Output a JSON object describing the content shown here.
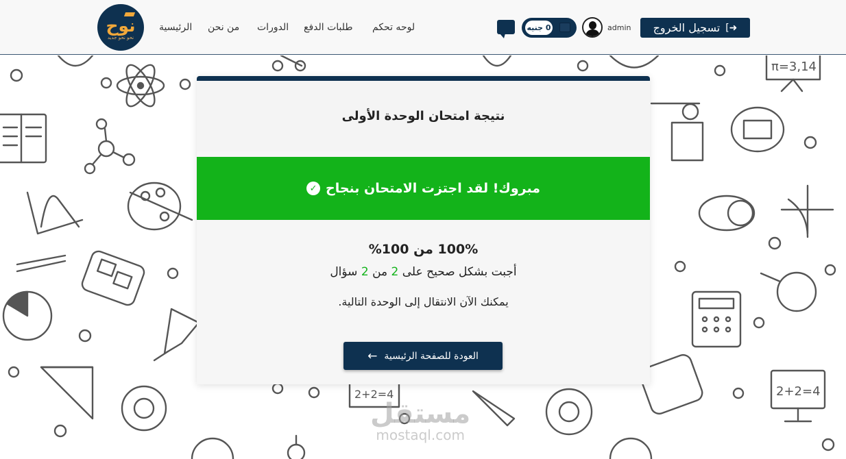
{
  "header": {
    "logo": {
      "word": "نوح",
      "tagline": "نحو نحو جديد"
    },
    "nav": [
      {
        "label": "الرئيسية"
      },
      {
        "label": "من نحن"
      },
      {
        "label": "الدورات"
      },
      {
        "label": "طلبات الدفع"
      },
      {
        "label": "لوحه تحكم"
      }
    ],
    "wallet": {
      "balance": "0 جنيه"
    },
    "username": "admin",
    "logout_label": "تسجيل الخروج"
  },
  "card": {
    "title": "نتيجة امتحان الوحدة الأولى",
    "success_message": "مبروك! لقد اجتزت الامتحان بنجاح",
    "score": "100% من 100%",
    "answered_prefix": "أجبت بشكل صحيح على",
    "correct_count": "2",
    "answered_middle": "من",
    "total_count": "2",
    "answered_suffix": "سؤال",
    "next_message": "يمكنك الآن الانتقال إلى الوحدة التالية.",
    "home_button_label": "العودة للصفحة الرئيسية"
  },
  "watermark": {
    "ar": "مستقل",
    "en": "mostaql.com"
  },
  "colors": {
    "primary": "#0e3150",
    "success": "#13b31a",
    "logo_accent": "#f2a83a"
  },
  "icons": {
    "logout": "sign-out-icon",
    "chat": "chat-bubble-icon",
    "wallet": "wallet-icon",
    "avatar": "user-avatar-icon",
    "success": "check-circle-icon",
    "back": "arrow-left-icon"
  }
}
